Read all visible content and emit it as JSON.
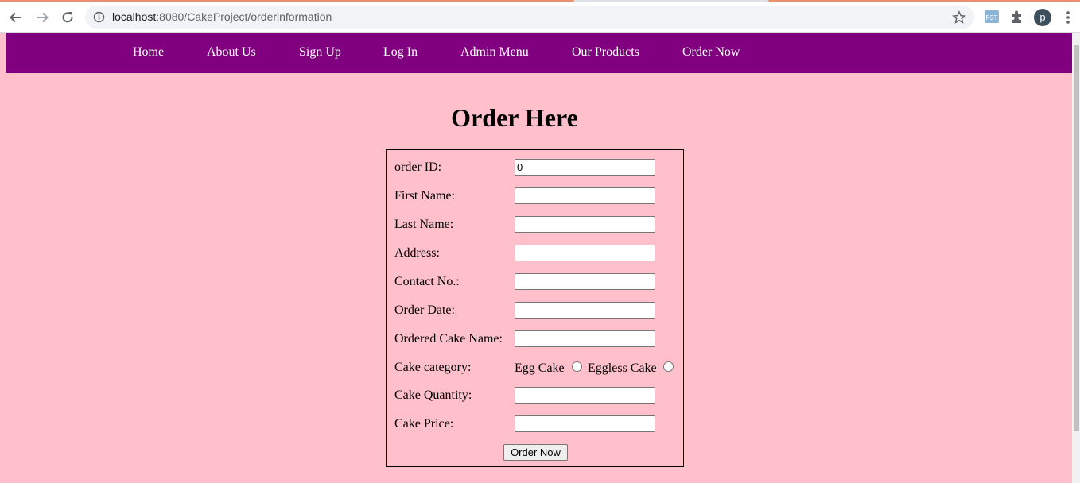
{
  "browser": {
    "url_host": "localhost",
    "url_rest": ":8080/CakeProject/orderinformation",
    "profile_initial": "p",
    "icons": [
      "back-icon",
      "forward-icon",
      "reload-icon",
      "site-info-icon",
      "bookmark-star-icon",
      "extension-fst-icon",
      "extensions-puzzle-icon",
      "menu-kebab-icon"
    ]
  },
  "nav": {
    "items": [
      {
        "label": "Home"
      },
      {
        "label": "About Us"
      },
      {
        "label": "Sign Up"
      },
      {
        "label": "Log In"
      },
      {
        "label": "Admin Menu"
      },
      {
        "label": "Our Products"
      },
      {
        "label": "Order Now"
      }
    ]
  },
  "page": {
    "title": "Order Here"
  },
  "form": {
    "order_id": {
      "label": "order ID:",
      "value": "0"
    },
    "first_name": {
      "label": "First Name:",
      "value": ""
    },
    "last_name": {
      "label": "Last Name:",
      "value": ""
    },
    "address": {
      "label": "Address:",
      "value": ""
    },
    "contact": {
      "label": "Contact No.:",
      "value": ""
    },
    "order_date": {
      "label": "Order Date:",
      "value": ""
    },
    "cake_name": {
      "label": "Ordered Cake Name:",
      "value": ""
    },
    "category": {
      "label": "Cake category:",
      "option1": "Egg Cake",
      "option2": "Eggless Cake"
    },
    "quantity": {
      "label": "Cake Quantity:",
      "value": ""
    },
    "price": {
      "label": "Cake Price:",
      "value": ""
    },
    "submit_label": "Order Now"
  },
  "colors": {
    "navbar": "#800080",
    "background": "#ffc0cb",
    "tab_accent": "#e8906f"
  }
}
